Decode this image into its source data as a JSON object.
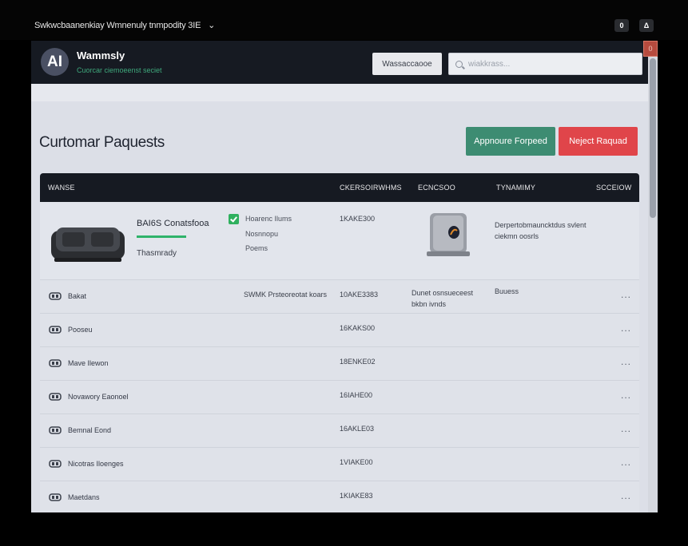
{
  "window": {
    "title": "Swkwcbaanenkiay Wmnenuly tnmpodity 3IE",
    "title_chevron": "⌄",
    "ctrl_left": "0",
    "ctrl_right": "Δ"
  },
  "header": {
    "logo_text": "AI",
    "brand": "Wammsly",
    "brand_sub": "Cuorcar ciemoeenst seciet",
    "button_label": "Wassaccaooe",
    "search_placeholder": "wiakkrass...",
    "corner_badge": "0"
  },
  "page": {
    "title": "Curtomar Paquests",
    "approve_label": "Appnoure Forpeed",
    "reject_label": "Neject Raquad"
  },
  "table": {
    "headers": [
      "WANSE",
      "CKERSOIRWHMS",
      "ECNCSOO",
      "TYNAMIMY",
      "SCCEIOW"
    ],
    "expanded": {
      "product_name": "BAI6S Conatsfooa",
      "product_sub": "Thasmrady",
      "features": [
        "Hoarenc Ilums",
        "Nosnnopu",
        "Poems"
      ],
      "serial": "1KAKE300",
      "description": "Derpertobmauncktdus svlent ciekmn oosrls"
    },
    "rows": [
      {
        "name": "Bakat",
        "col2": "SWMK Prsteoreotat koars",
        "serial": "10AKE3383",
        "status": "Dunet osnsueceest bkbn ivnds",
        "warranty": "Buuess",
        "more": "..."
      },
      {
        "name": "Pooseu",
        "col2": "",
        "serial": "16KAKS00",
        "status": "",
        "warranty": "",
        "more": "..."
      },
      {
        "name": "Mave Ilewon",
        "col2": "",
        "serial": "18ENKE02",
        "status": "",
        "warranty": "",
        "more": "..."
      },
      {
        "name": "Novawory Eaonoel",
        "col2": "",
        "serial": "16IAHE00",
        "status": "",
        "warranty": "",
        "more": "..."
      },
      {
        "name": "Bemnal Eond",
        "col2": "",
        "serial": "16AKLE03",
        "status": "",
        "warranty": "",
        "more": "..."
      },
      {
        "name": "Nicotras Iloenges",
        "col2": "",
        "serial": "1VIAKE00",
        "status": "",
        "warranty": "",
        "more": "..."
      },
      {
        "name": "Maetdans",
        "col2": "",
        "serial": "1KIAKE83",
        "status": "",
        "warranty": "",
        "more": "..."
      }
    ]
  },
  "colors": {
    "header_bg": "#161a22",
    "accent_green": "#3d8c72",
    "reject_red": "#e0454a",
    "success_green": "#2fb36a"
  }
}
